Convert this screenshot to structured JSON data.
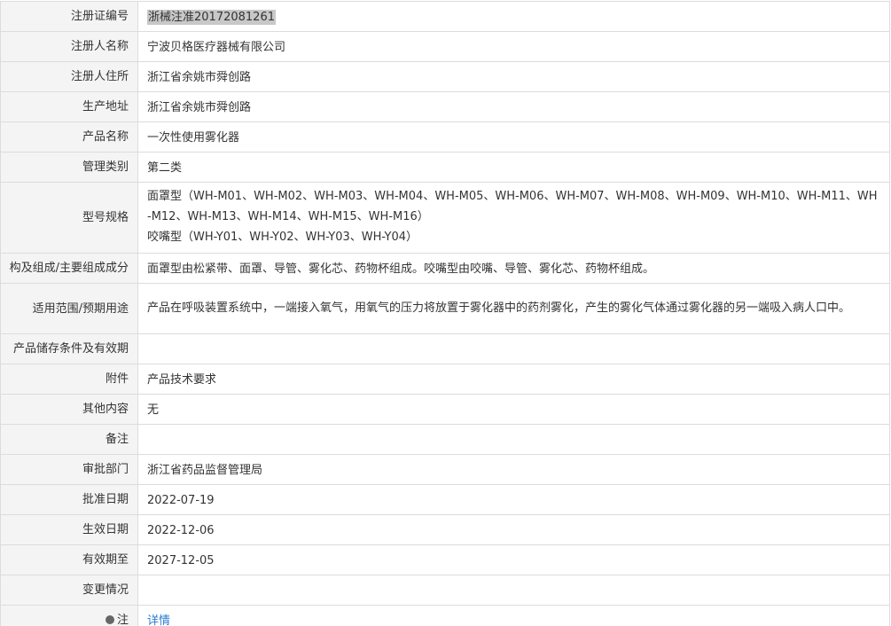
{
  "rows": [
    {
      "label": "注册证编号",
      "value": "浙械注准20172081261"
    },
    {
      "label": "注册人名称",
      "value": "宁波贝格医疗器械有限公司"
    },
    {
      "label": "注册人住所",
      "value": "浙江省余姚市舜创路"
    },
    {
      "label": "生产地址",
      "value": "浙江省余姚市舜创路"
    },
    {
      "label": "产品名称",
      "value": "一次性使用雾化器"
    },
    {
      "label": "管理类别",
      "value": "第二类"
    },
    {
      "label": "型号规格",
      "value_line1": "面罩型（WH-M01、WH-M02、WH-M03、WH-M04、WH-M05、WH-M06、WH-M07、WH-M08、WH-M09、WH-M10、WH-M11、WH-M12、WH-M13、WH-M14、WH-M15、WH-M16）",
      "value_line2": "咬嘴型（WH-Y01、WH-Y02、WH-Y03、WH-Y04）"
    },
    {
      "label": "结构及组成/主要组成成分",
      "label_visible": "构及组成/主要组成成分",
      "value": "面罩型由松紧带、面罩、导管、雾化芯、药物杯组成。咬嘴型由咬嘴、导管、雾化芯、药物杯组成。"
    },
    {
      "label": "适用范围/预期用途",
      "value": "产品在呼吸装置系统中，一端接入氧气，用氧气的压力将放置于雾化器中的药剂雾化，产生的雾化气体通过雾化器的另一端吸入病人口中。"
    },
    {
      "label": "产品储存条件及有效期",
      "value": ""
    },
    {
      "label": "附件",
      "value": "产品技术要求"
    },
    {
      "label": "其他内容",
      "value": "无"
    },
    {
      "label": "备注",
      "value": ""
    },
    {
      "label": "审批部门",
      "value": "浙江省药品监督管理局"
    },
    {
      "label": "批准日期",
      "value": "2022-07-19"
    },
    {
      "label": "生效日期",
      "value": "2022-12-06"
    },
    {
      "label": "有效期至",
      "value": "2027-12-05"
    },
    {
      "label": "变更情况",
      "value": ""
    },
    {
      "label": "注",
      "value": "详情"
    }
  ],
  "colors": {
    "label_bg": "#f4f4f4",
    "border": "#dcdcdc",
    "text": "#333333",
    "link": "#2a7ad2",
    "highlight": "#c8c8c8"
  },
  "icons": {
    "note": "info-dot-icon"
  }
}
